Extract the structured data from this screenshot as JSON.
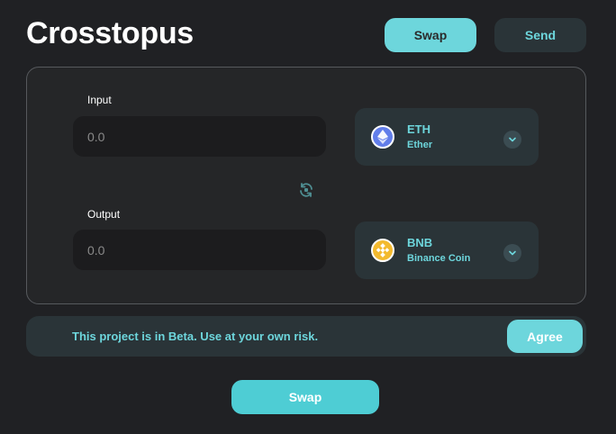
{
  "app": {
    "title": "Crosstopus"
  },
  "nav": {
    "swap_label": "Swap",
    "send_label": "Send"
  },
  "input": {
    "label": "Input",
    "placeholder": "0.0",
    "token": {
      "symbol": "ETH",
      "name": "Ether",
      "icon": "ethereum-icon",
      "color": "#627eea"
    }
  },
  "output": {
    "label": "Output",
    "placeholder": "0.0",
    "token": {
      "symbol": "BNB",
      "name": "Binance Coin",
      "icon": "binance-icon",
      "color": "#f3ba2f"
    }
  },
  "switch": {
    "icon": "switch-direction-icon"
  },
  "beta": {
    "message": "This project is in Beta. Use at your own risk.",
    "agree_label": "Agree"
  },
  "footer": {
    "swap_label": "Swap"
  },
  "colors": {
    "accent": "#6dd6dc",
    "background": "#202124",
    "panel": "#252628",
    "chip": "#2a3438"
  }
}
